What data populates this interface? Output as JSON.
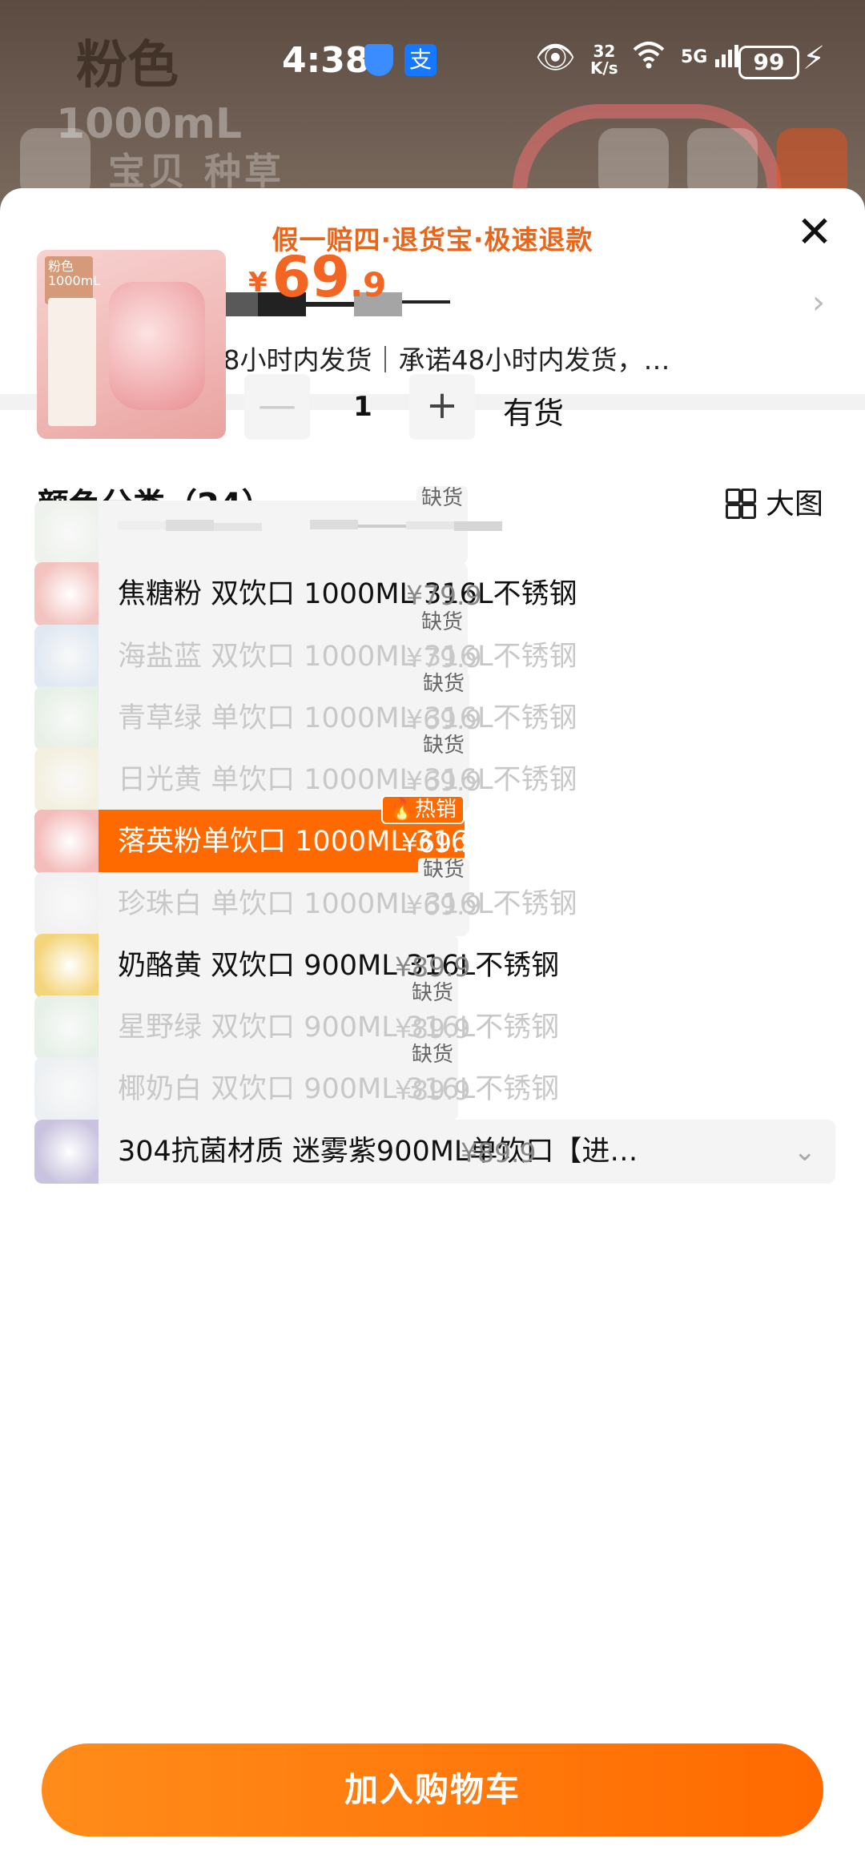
{
  "background": {
    "color_label": "粉色",
    "volume_label": "1000mL",
    "tabs": "宝贝  种草"
  },
  "status_bar": {
    "time": "4:38",
    "net_speed_value": "32",
    "net_speed_unit": "K/s",
    "signal": "5G",
    "battery": "99",
    "alipay_glyph": "支"
  },
  "sheet": {
    "banner": "假一赔四·退货宝·极速退款",
    "close_label": "✕",
    "shipping": "包邮 预计18小时内发货｜承诺48小时内发货，…",
    "addr_chevron": "›"
  },
  "product": {
    "thumb_tag": "粉色 1000mL",
    "price_currency": "¥",
    "price_int": "69",
    "price_dec": ".9",
    "qty_minus": "—",
    "qty_value": "1",
    "qty_plus": "+",
    "stock": "有货"
  },
  "section": {
    "title": "颜色分类（24）",
    "big_view": "大图"
  },
  "options": [
    {
      "label": "",
      "price": "",
      "state": "oos",
      "badge": "缺货",
      "img_color": "#e6efe1"
    },
    {
      "label": "焦糖粉 双饮口 1000ML 316L不锈钢",
      "price": "¥79.9",
      "state": "normal",
      "badge": "",
      "img_color": "#f3c3bf"
    },
    {
      "label": "海盐蓝 双饮口 1000ML 316L不锈钢",
      "price": "¥79.9",
      "state": "oos",
      "badge": "缺货",
      "img_color": "#c8dbf0"
    },
    {
      "label": "青草绿 单饮口 1000ML 316L不锈钢",
      "price": "¥69.9",
      "state": "oos",
      "badge": "缺货",
      "img_color": "#d8ecd5"
    },
    {
      "label": "日光黄 单饮口 1000ML 316L不锈钢",
      "price": "¥69.9",
      "state": "oos",
      "badge": "缺货",
      "img_color": "#f3ebc7"
    },
    {
      "label": "落英粉单饮口 1000ML 316L不锈钢",
      "price": "¥69.9",
      "state": "selected",
      "badge": "🔥热销",
      "img_color": "#f4bcbb"
    },
    {
      "label": "珍珠白 单饮口 1000ML 316L不锈钢",
      "price": "¥69.9",
      "state": "oos",
      "badge": "缺货",
      "img_color": "#eeeeee"
    },
    {
      "label": "奶酪黄 双饮口 900ML 316L不锈钢",
      "price": "¥89.9",
      "state": "normal",
      "badge": "",
      "img_color": "#f5d57c"
    },
    {
      "label": "星野绿 双饮口 900ML 316L不锈钢",
      "price": "¥89.9",
      "state": "oos",
      "badge": "缺货",
      "img_color": "#d6ecd8"
    },
    {
      "label": "椰奶白 双饮口 900ML 316L不锈钢",
      "price": "¥89.9",
      "state": "oos",
      "badge": "缺货",
      "img_color": "#e5ebf0"
    },
    {
      "label": "304抗菌材质 迷雾紫900ML单饮口【进…",
      "price": "¥89.9",
      "state": "normal",
      "badge": "",
      "img_color": "#c9c3df"
    }
  ],
  "cta": {
    "label": "加入购物车"
  },
  "colors": {
    "accent": "#ff6a00",
    "banner": "#e8661c",
    "price": "#f26522"
  }
}
